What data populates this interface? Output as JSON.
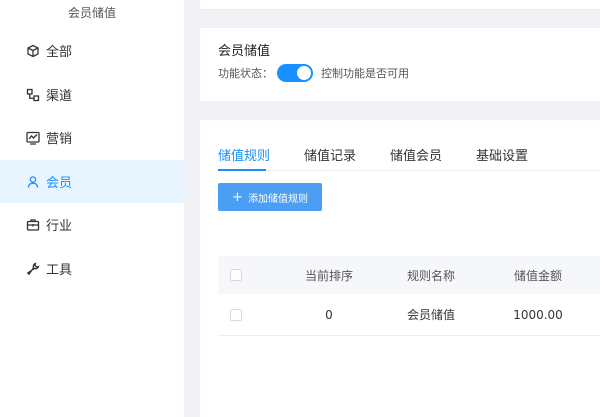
{
  "sidebar": {
    "title": "会员储值",
    "items": [
      {
        "label": "全部",
        "icon": "cube-icon"
      },
      {
        "label": "渠道",
        "icon": "channel-icon"
      },
      {
        "label": "营销",
        "icon": "chart-icon"
      },
      {
        "label": "会员",
        "icon": "user-icon",
        "active": true
      },
      {
        "label": "行业",
        "icon": "briefcase-icon"
      },
      {
        "label": "工具",
        "icon": "wrench-icon"
      }
    ]
  },
  "header": {
    "title": "会员储值",
    "status_label": "功能状态：",
    "status_on": true,
    "status_hint": "控制功能是否可用"
  },
  "tabs": [
    {
      "label": "储值规则",
      "active": true
    },
    {
      "label": "储值记录"
    },
    {
      "label": "储值会员"
    },
    {
      "label": "基础设置"
    }
  ],
  "toolbar": {
    "add_label": "添加储值规则"
  },
  "table": {
    "columns": [
      "当前排序",
      "规则名称",
      "储值金额"
    ],
    "rows": [
      {
        "order": "0",
        "name": "会员储值",
        "amount": "1000.00"
      }
    ]
  },
  "colors": {
    "accent": "#1890ff",
    "button": "#4a9ff5",
    "active_bg": "#e8f4ff"
  }
}
